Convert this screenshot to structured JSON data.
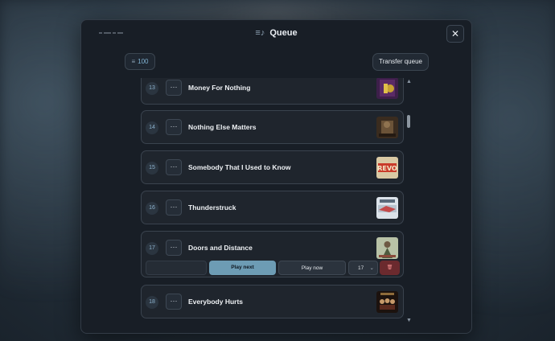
{
  "header": {
    "title": "Queue",
    "close_label": "✕",
    "queue_icon": "≡♪"
  },
  "toolbar": {
    "count_icon": "≡",
    "count": "100",
    "transfer_label": "Transfer queue"
  },
  "queue": [
    {
      "index": "13",
      "title": "Money For Nothing"
    },
    {
      "index": "14",
      "title": "Nothing Else Matters"
    },
    {
      "index": "15",
      "title": "Somebody That I Used to Know",
      "art_text": "REVO"
    },
    {
      "index": "16",
      "title": "Thunderstruck"
    },
    {
      "index": "17",
      "title": "Doors and Distance"
    },
    {
      "index": "18",
      "title": "Everybody Hurts"
    }
  ],
  "row_menu_label": "···",
  "expanded_actions": {
    "play_next": "Play next",
    "play_now": "Play now",
    "position_value": "17",
    "chevron": "⌄",
    "delete_icon": "🗑"
  },
  "scroll": {
    "up": "▲",
    "down": "▼"
  }
}
